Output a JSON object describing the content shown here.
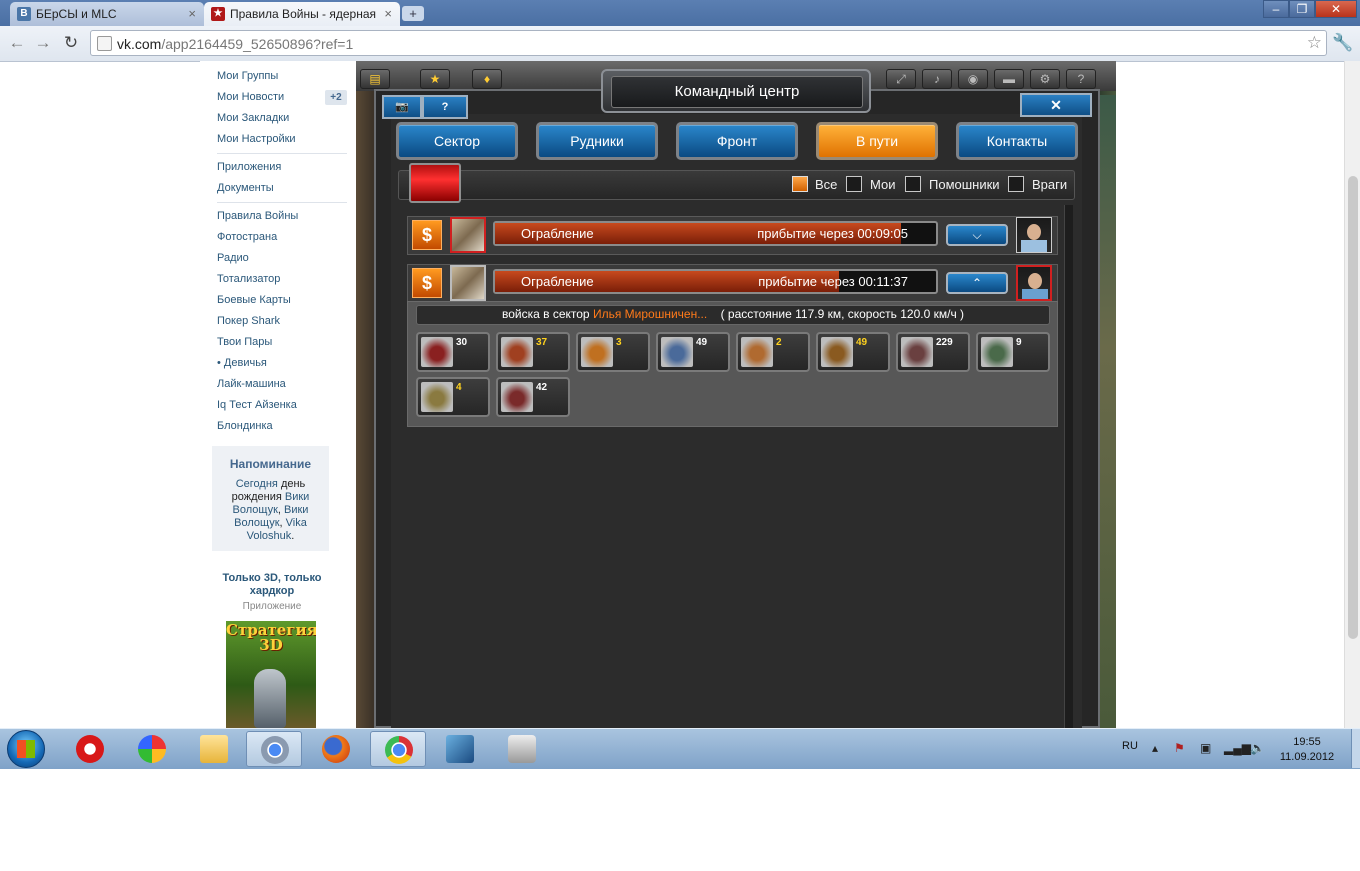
{
  "browser": {
    "tabs": [
      {
        "title": "БЕрСЫ и MLC",
        "icon": "vk-icon",
        "active": false
      },
      {
        "title": "Правила Войны - ядерная",
        "icon": "game-star-icon",
        "active": true
      }
    ],
    "new_tab": "+",
    "url_host": "vk.com",
    "url_path": "/app2164459_52650896?ref=1",
    "window_controls": [
      "minimize-icon",
      "maximize-icon",
      "close-icon"
    ]
  },
  "vk_sidebar": {
    "menu": [
      "Мои Группы",
      "Мои Новости",
      "Мои Закладки",
      "Мои Настройки"
    ],
    "news_badge": "+2",
    "apps_menu": [
      "Приложения",
      "Документы"
    ],
    "apps": [
      "Правила Войны",
      "Фотострана",
      "Радио",
      "Тотализатор",
      "Боевые Карты",
      "Покер Shark",
      "Твои Пары",
      "• Девичья",
      "Лайк-машина",
      "Iq Тест Айзенка",
      "Блондинка"
    ],
    "reminder": {
      "title": "Напоминание",
      "today": "Сегодня",
      "birthday_text": "день рождения",
      "names": [
        "Вики Волощук",
        "Вики Волощук",
        "Vika Voloshuk"
      ],
      "sep1": ", ",
      "sep2": ", ",
      "end": "."
    },
    "ad": {
      "title": "Только 3D, только хардкор",
      "subtitle": "Приложение",
      "image_text": "Стратегия 3D"
    }
  },
  "game": {
    "window_title": "Командный центр",
    "camera_button": "camera-icon",
    "help_button": "?",
    "close_button": "✕",
    "nav_tabs": [
      {
        "label": "Сектор",
        "active": false
      },
      {
        "label": "Рудники",
        "active": false
      },
      {
        "label": "Фронт",
        "active": false
      },
      {
        "label": "В пути",
        "active": true
      },
      {
        "label": "Контакты",
        "active": false
      }
    ],
    "filters": [
      {
        "label": "Все",
        "checked": true
      },
      {
        "label": "Мои",
        "checked": false
      },
      {
        "label": "Помошники",
        "checked": false
      },
      {
        "label": "Враги",
        "checked": false
      }
    ],
    "movements": [
      {
        "type": "Ограбление",
        "arrival": "прибытие через 00:09:05",
        "progress": 0.92,
        "toggle": "chevron-down-icon"
      },
      {
        "type": "Ограбление",
        "arrival": "прибытие через 00:11:37",
        "progress": 0.78,
        "toggle": "chevron-up-icon"
      }
    ],
    "detail": {
      "prefix": "войска в сектор",
      "target": "Илья Мирошничен...",
      "info": "( расстояние 117.9 км, скорость 120.0 км/ч )"
    },
    "units": [
      {
        "count": "30",
        "highlight": false,
        "color": "#8a2020"
      },
      {
        "count": "37",
        "highlight": true,
        "color": "#a04020"
      },
      {
        "count": "3",
        "highlight": true,
        "color": "#c07020"
      },
      {
        "count": "49",
        "highlight": false,
        "color": "#4a6a9a"
      },
      {
        "count": "2",
        "highlight": true,
        "color": "#b06a30"
      },
      {
        "count": "49",
        "highlight": true,
        "color": "#8a5a20"
      },
      {
        "count": "229",
        "highlight": false,
        "color": "#6a4040"
      },
      {
        "count": "9",
        "highlight": false,
        "color": "#4a6a4a"
      },
      {
        "count": "4",
        "highlight": true,
        "color": "#8a7a40"
      },
      {
        "count": "42",
        "highlight": false,
        "color": "#7a2a2a"
      }
    ]
  },
  "taskbar": {
    "apps": [
      "opera-icon",
      "picasa-icon",
      "explorer-icon",
      "chrome-icon",
      "firefox-icon",
      "chrome-icon",
      "monitor-icon",
      "camera-icon"
    ],
    "language": "RU",
    "time": "19:55",
    "date": "11.09.2012"
  }
}
